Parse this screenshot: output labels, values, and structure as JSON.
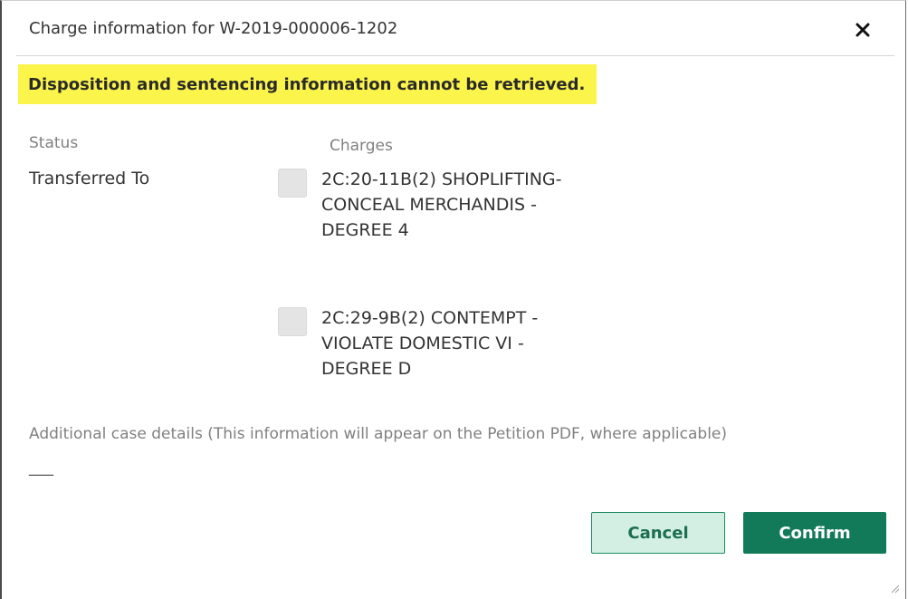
{
  "dialog": {
    "title": "Charge information for W-2019-000006-1202",
    "close_icon": "close-icon",
    "close_glyph": "✕"
  },
  "alert": {
    "text": "Disposition and sentencing information cannot be retrieved.",
    "color": "#fbf44b"
  },
  "labels": {
    "status": "Status",
    "charges": "Charges"
  },
  "status_value": "Transferred To",
  "charges": [
    {
      "text": "2C:20-11B(2) SHOPLIFTING-CONCEAL MERCHANDIS - DEGREE 4",
      "checked": false
    },
    {
      "text": "2C:29-9B(2) CONTEMPT - VIOLATE DOMESTIC VI - DEGREE D",
      "checked": false
    }
  ],
  "additional": {
    "label": "Additional case details (This information will appear on the Petition PDF, where applicable)",
    "value": "___"
  },
  "buttons": {
    "cancel": "Cancel",
    "confirm": "Confirm"
  },
  "colors": {
    "primary": "#137a59",
    "secondary_bg": "#d3efe3"
  }
}
